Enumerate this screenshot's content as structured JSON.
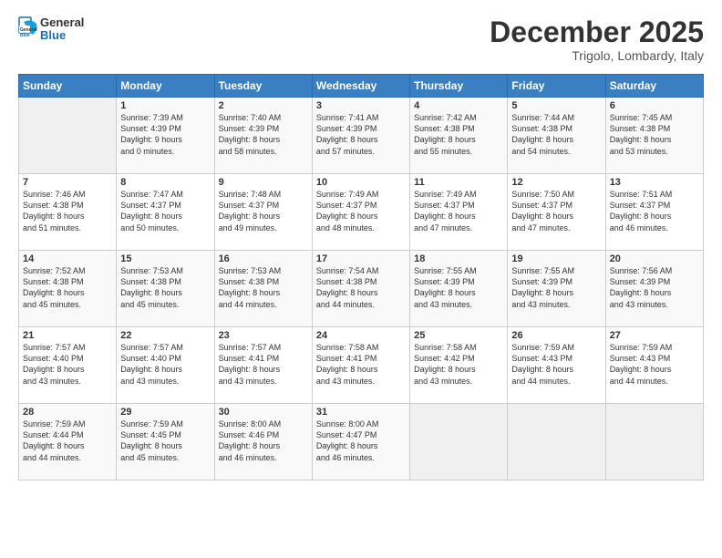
{
  "logo": {
    "general": "General",
    "blue": "Blue"
  },
  "header": {
    "month": "December 2025",
    "location": "Trigolo, Lombardy, Italy"
  },
  "days": [
    "Sunday",
    "Monday",
    "Tuesday",
    "Wednesday",
    "Thursday",
    "Friday",
    "Saturday"
  ],
  "weeks": [
    [
      {
        "date": "",
        "info": ""
      },
      {
        "date": "1",
        "info": "Sunrise: 7:39 AM\nSunset: 4:39 PM\nDaylight: 9 hours\nand 0 minutes."
      },
      {
        "date": "2",
        "info": "Sunrise: 7:40 AM\nSunset: 4:39 PM\nDaylight: 8 hours\nand 58 minutes."
      },
      {
        "date": "3",
        "info": "Sunrise: 7:41 AM\nSunset: 4:39 PM\nDaylight: 8 hours\nand 57 minutes."
      },
      {
        "date": "4",
        "info": "Sunrise: 7:42 AM\nSunset: 4:38 PM\nDaylight: 8 hours\nand 55 minutes."
      },
      {
        "date": "5",
        "info": "Sunrise: 7:44 AM\nSunset: 4:38 PM\nDaylight: 8 hours\nand 54 minutes."
      },
      {
        "date": "6",
        "info": "Sunrise: 7:45 AM\nSunset: 4:38 PM\nDaylight: 8 hours\nand 53 minutes."
      }
    ],
    [
      {
        "date": "7",
        "info": "Sunrise: 7:46 AM\nSunset: 4:38 PM\nDaylight: 8 hours\nand 51 minutes."
      },
      {
        "date": "8",
        "info": "Sunrise: 7:47 AM\nSunset: 4:37 PM\nDaylight: 8 hours\nand 50 minutes."
      },
      {
        "date": "9",
        "info": "Sunrise: 7:48 AM\nSunset: 4:37 PM\nDaylight: 8 hours\nand 49 minutes."
      },
      {
        "date": "10",
        "info": "Sunrise: 7:49 AM\nSunset: 4:37 PM\nDaylight: 8 hours\nand 48 minutes."
      },
      {
        "date": "11",
        "info": "Sunrise: 7:49 AM\nSunset: 4:37 PM\nDaylight: 8 hours\nand 47 minutes."
      },
      {
        "date": "12",
        "info": "Sunrise: 7:50 AM\nSunset: 4:37 PM\nDaylight: 8 hours\nand 47 minutes."
      },
      {
        "date": "13",
        "info": "Sunrise: 7:51 AM\nSunset: 4:37 PM\nDaylight: 8 hours\nand 46 minutes."
      }
    ],
    [
      {
        "date": "14",
        "info": "Sunrise: 7:52 AM\nSunset: 4:38 PM\nDaylight: 8 hours\nand 45 minutes."
      },
      {
        "date": "15",
        "info": "Sunrise: 7:53 AM\nSunset: 4:38 PM\nDaylight: 8 hours\nand 45 minutes."
      },
      {
        "date": "16",
        "info": "Sunrise: 7:53 AM\nSunset: 4:38 PM\nDaylight: 8 hours\nand 44 minutes."
      },
      {
        "date": "17",
        "info": "Sunrise: 7:54 AM\nSunset: 4:38 PM\nDaylight: 8 hours\nand 44 minutes."
      },
      {
        "date": "18",
        "info": "Sunrise: 7:55 AM\nSunset: 4:39 PM\nDaylight: 8 hours\nand 43 minutes."
      },
      {
        "date": "19",
        "info": "Sunrise: 7:55 AM\nSunset: 4:39 PM\nDaylight: 8 hours\nand 43 minutes."
      },
      {
        "date": "20",
        "info": "Sunrise: 7:56 AM\nSunset: 4:39 PM\nDaylight: 8 hours\nand 43 minutes."
      }
    ],
    [
      {
        "date": "21",
        "info": "Sunrise: 7:57 AM\nSunset: 4:40 PM\nDaylight: 8 hours\nand 43 minutes."
      },
      {
        "date": "22",
        "info": "Sunrise: 7:57 AM\nSunset: 4:40 PM\nDaylight: 8 hours\nand 43 minutes."
      },
      {
        "date": "23",
        "info": "Sunrise: 7:57 AM\nSunset: 4:41 PM\nDaylight: 8 hours\nand 43 minutes."
      },
      {
        "date": "24",
        "info": "Sunrise: 7:58 AM\nSunset: 4:41 PM\nDaylight: 8 hours\nand 43 minutes."
      },
      {
        "date": "25",
        "info": "Sunrise: 7:58 AM\nSunset: 4:42 PM\nDaylight: 8 hours\nand 43 minutes."
      },
      {
        "date": "26",
        "info": "Sunrise: 7:59 AM\nSunset: 4:43 PM\nDaylight: 8 hours\nand 44 minutes."
      },
      {
        "date": "27",
        "info": "Sunrise: 7:59 AM\nSunset: 4:43 PM\nDaylight: 8 hours\nand 44 minutes."
      }
    ],
    [
      {
        "date": "28",
        "info": "Sunrise: 7:59 AM\nSunset: 4:44 PM\nDaylight: 8 hours\nand 44 minutes."
      },
      {
        "date": "29",
        "info": "Sunrise: 7:59 AM\nSunset: 4:45 PM\nDaylight: 8 hours\nand 45 minutes."
      },
      {
        "date": "30",
        "info": "Sunrise: 8:00 AM\nSunset: 4:46 PM\nDaylight: 8 hours\nand 46 minutes."
      },
      {
        "date": "31",
        "info": "Sunrise: 8:00 AM\nSunset: 4:47 PM\nDaylight: 8 hours\nand 46 minutes."
      },
      {
        "date": "",
        "info": ""
      },
      {
        "date": "",
        "info": ""
      },
      {
        "date": "",
        "info": ""
      }
    ]
  ]
}
